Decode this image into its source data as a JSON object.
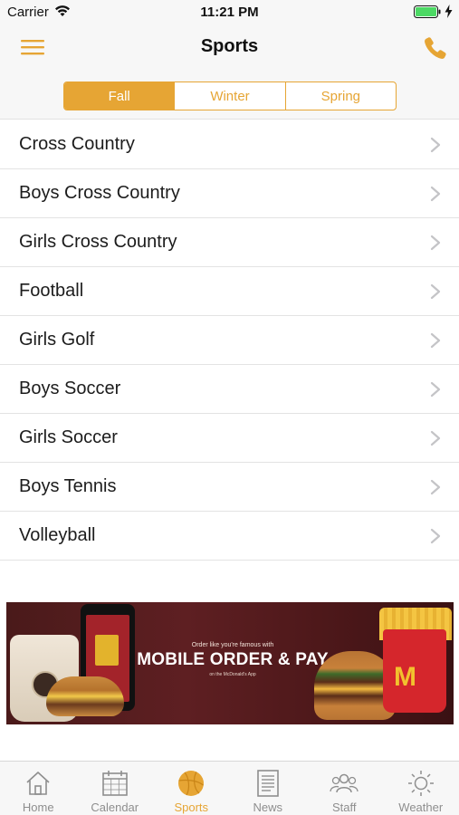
{
  "status": {
    "carrier": "Carrier",
    "time": "11:21 PM"
  },
  "nav": {
    "title": "Sports",
    "menu_icon": "hamburger-menu-icon",
    "phone_icon": "phone-icon"
  },
  "seasons": {
    "tabs": [
      "Fall",
      "Winter",
      "Spring"
    ],
    "selected": "Fall"
  },
  "sports": [
    "Cross Country",
    "Boys Cross Country",
    "Girls Cross Country",
    "Football",
    "Girls Golf",
    "Boys Soccer",
    "Girls Soccer",
    "Boys Tennis",
    "Volleyball"
  ],
  "ad": {
    "kicker": "Order like you're famous with",
    "headline": "MOBILE ORDER & PAY",
    "subline": "on the McDonald's App",
    "logo_letter": "M"
  },
  "tabbar": {
    "items": [
      {
        "label": "Home",
        "icon": "home-icon"
      },
      {
        "label": "Calendar",
        "icon": "calendar-icon"
      },
      {
        "label": "Sports",
        "icon": "basketball-icon"
      },
      {
        "label": "News",
        "icon": "newspaper-icon"
      },
      {
        "label": "Staff",
        "icon": "staff-icon"
      },
      {
        "label": "Weather",
        "icon": "sun-icon"
      }
    ],
    "selected": "Sports"
  },
  "colors": {
    "accent": "#e6a534",
    "background": "#f7f7f7",
    "inactive_tab": "#8e8e8e"
  }
}
